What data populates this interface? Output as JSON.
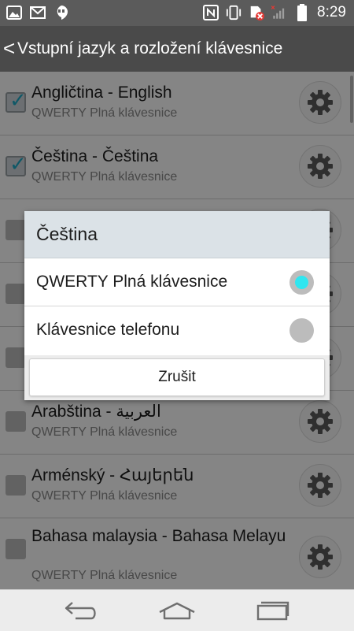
{
  "status_bar": {
    "time": "8:29",
    "left_icons": [
      "image-icon",
      "gmail-icon",
      "hangouts-icon"
    ],
    "right_icons": [
      "nfc-icon",
      "vibrate-icon",
      "sim-error-icon",
      "signal-icon",
      "battery-icon"
    ]
  },
  "header": {
    "back_glyph": "<",
    "title": "Vstupní jazyk a rozložení klávesnice"
  },
  "languages": [
    {
      "name": "Angličtina - English",
      "layout": "QWERTY Plná klávesnice",
      "checked": true
    },
    {
      "name": "Čeština - Čeština",
      "layout": "QWERTY Plná klávesnice",
      "checked": true
    },
    {
      "name": "",
      "layout": "",
      "checked": false
    },
    {
      "name": "",
      "layout": "",
      "checked": false
    },
    {
      "name": "",
      "layout": "",
      "checked": false
    },
    {
      "name": "Arabština - العربية",
      "layout": "QWERTY Plná klávesnice",
      "checked": false
    },
    {
      "name": "Arménský - Հայերեն",
      "layout": "QWERTY Plná klávesnice",
      "checked": false
    },
    {
      "name": "Bahasa malaysia - Bahasa Melayu",
      "layout": "QWERTY Plná klávesnice",
      "checked": false
    }
  ],
  "dialog": {
    "title": "Čeština",
    "options": [
      {
        "label": "QWERTY Plná klávesnice",
        "selected": true
      },
      {
        "label": "Klávesnice telefonu",
        "selected": false
      }
    ],
    "cancel_label": "Zrušit"
  },
  "nav_bar": {
    "buttons": [
      "back-icon",
      "home-icon",
      "recent-apps-icon"
    ]
  },
  "colors": {
    "accent": "#2fe6f0",
    "check": "#1ea9c6",
    "title_bar": "#4a4a4a",
    "status_bar": "#5b5b5b"
  }
}
